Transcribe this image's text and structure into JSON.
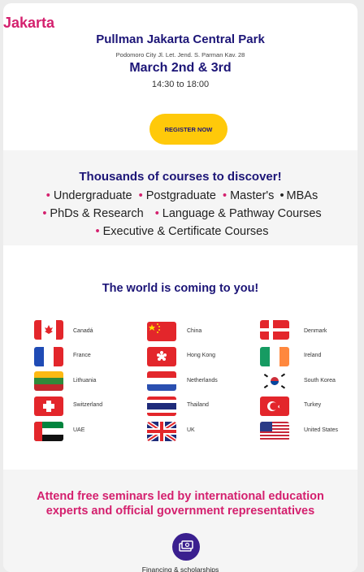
{
  "event": {
    "city": "Jakarta",
    "venue": "Pullman Jakarta Central Park",
    "address": "Podomoro City Jl. Let. Jend. S. Parman Kav. 28",
    "dates": "March 2nd & 3rd",
    "time": "14:30 to 18:00",
    "register_label": "REGISTER NOW"
  },
  "courses": {
    "heading": "Thousands of courses to discover!",
    "row1": [
      "Undergraduate",
      "Postgraduate",
      "Master's",
      "MBAs"
    ],
    "row2": [
      "PhDs & Research",
      "Language & Pathway Courses"
    ],
    "row3": [
      "Executive & Certificate Courses"
    ]
  },
  "world": {
    "heading": "The world is coming to you!",
    "countries": [
      {
        "name": "Canadá",
        "icon": "canada-flag-icon"
      },
      {
        "name": "China",
        "icon": "china-flag-icon"
      },
      {
        "name": "Denmark",
        "icon": "denmark-flag-icon"
      },
      {
        "name": "France",
        "icon": "france-flag-icon"
      },
      {
        "name": "Hong Kong",
        "icon": "hong-kong-flag-icon"
      },
      {
        "name": "Ireland",
        "icon": "ireland-flag-icon"
      },
      {
        "name": "Lithuania",
        "icon": "lithuania-flag-icon"
      },
      {
        "name": "Netherlands",
        "icon": "netherlands-flag-icon"
      },
      {
        "name": "South Korea",
        "icon": "south-korea-flag-icon"
      },
      {
        "name": "Switzerland",
        "icon": "switzerland-flag-icon"
      },
      {
        "name": "Thailand",
        "icon": "thailand-flag-icon"
      },
      {
        "name": "Turkey",
        "icon": "turkey-flag-icon"
      },
      {
        "name": "UAE",
        "icon": "uae-flag-icon"
      },
      {
        "name": "UK",
        "icon": "uk-flag-icon"
      },
      {
        "name": "United States",
        "icon": "usa-flag-icon"
      }
    ]
  },
  "seminars": {
    "text": "Attend free seminars led by international education experts and official government representatives",
    "feature_label": "Financing & scholarships",
    "feature_icon": "money-icon"
  },
  "colors": {
    "accent_pink": "#d4206e",
    "navy": "#1c1577",
    "button_yellow": "#ffc90a"
  }
}
